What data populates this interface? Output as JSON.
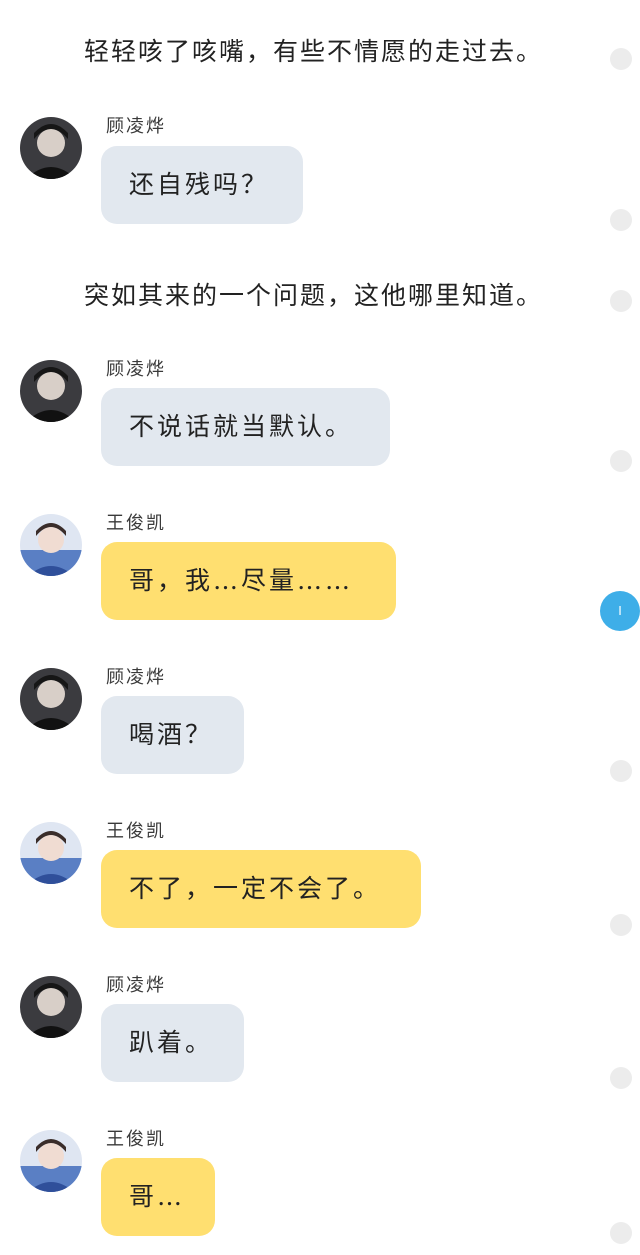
{
  "narration": [
    "轻轻咳了咳嘴，有些不情愿的走过去。",
    "突如其来的一个问题，这他哪里知道。"
  ],
  "messages": [
    {
      "sender": "顾凌烨",
      "text": "还自残吗？",
      "side": "gu"
    },
    {
      "sender": "顾凌烨",
      "text": "不说话就当默认。",
      "side": "gu"
    },
    {
      "sender": "王俊凯",
      "text": "哥，我…尽量……",
      "side": "wang"
    },
    {
      "sender": "顾凌烨",
      "text": "喝酒？",
      "side": "gu"
    },
    {
      "sender": "王俊凯",
      "text": "不了，一定不会了。",
      "side": "wang"
    },
    {
      "sender": "顾凌烨",
      "text": "趴着。",
      "side": "gu"
    },
    {
      "sender": "王俊凯",
      "text": "哥…",
      "side": "wang"
    }
  ],
  "scroll_indicator": {
    "label": "I"
  },
  "colors": {
    "gu_bubble": "#e2e8ef",
    "wang_bubble": "#ffdf70",
    "scroll_accent": "#3eaee8",
    "timeline_dot": "#ececec"
  },
  "icons": {
    "gu_avatar": "dark-portrait-avatar-icon",
    "wang_avatar": "blue-portrait-avatar-icon"
  }
}
